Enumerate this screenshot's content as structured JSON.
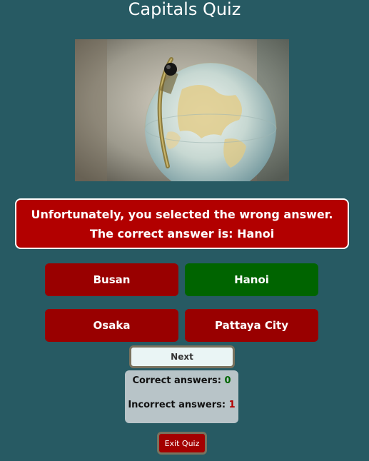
{
  "quiz": {
    "title": "Capitals Quiz",
    "feedback": "Unfortunately, you selected the wrong answer. The correct answer is: Hanoi",
    "answers": [
      {
        "label": "Busan",
        "status": "wrong"
      },
      {
        "label": "Hanoi",
        "status": "correct"
      },
      {
        "label": "Osaka",
        "status": "wrong"
      },
      {
        "label": "Pattaya City",
        "status": "wrong"
      }
    ],
    "next_label": "Next",
    "score": {
      "correct_label": "Correct answers:",
      "correct_value": "0",
      "incorrect_label": "Incorrect answers:",
      "incorrect_value": "1"
    },
    "exit_label": "Exit Quiz",
    "image_subject": "globe-photo"
  },
  "colors": {
    "background": "#275a63",
    "wrong": "#990000",
    "correct": "#006400",
    "feedback_bg": "#b20000"
  }
}
